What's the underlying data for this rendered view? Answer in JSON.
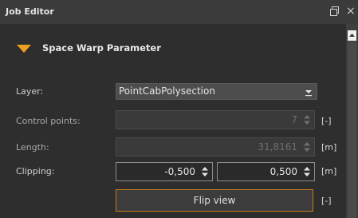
{
  "window": {
    "title": "Job Editor",
    "icons": [
      "float-icon",
      "close-icon"
    ],
    "close_glyph": "×"
  },
  "section": {
    "title": "Space Warp Parameter",
    "expanded": true,
    "accent_color": "#f0a020"
  },
  "layer": {
    "label": "Layer:",
    "value": "PointCabPolysection"
  },
  "control_points": {
    "label": "Control points:",
    "value": "7",
    "unit": "[-]"
  },
  "length": {
    "label": "Length:",
    "value": "31,8161",
    "unit": "[m]"
  },
  "clipping": {
    "label": "Clipping:",
    "min": "-0,500",
    "max": "0,500",
    "unit": "[m]"
  },
  "flip": {
    "label": "Flip view",
    "unit": "[-]"
  }
}
